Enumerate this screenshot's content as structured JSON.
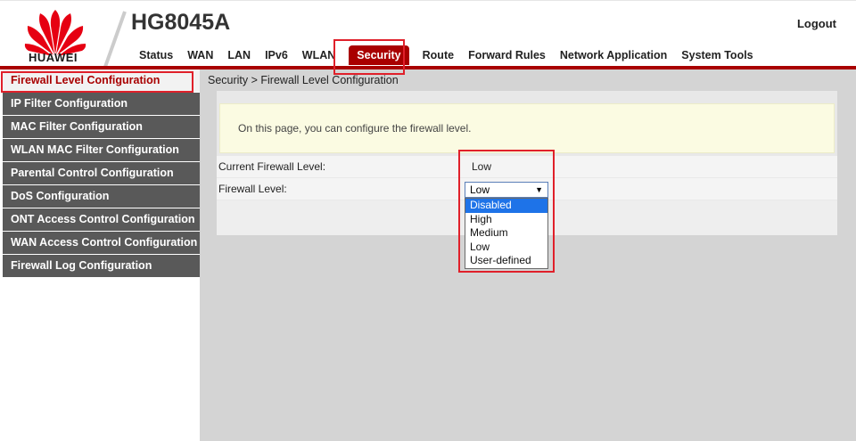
{
  "header": {
    "brand": "HUAWEI",
    "product": "HG8045A",
    "logout_label": "Logout"
  },
  "nav": {
    "items": [
      {
        "label": "Status"
      },
      {
        "label": "WAN"
      },
      {
        "label": "LAN"
      },
      {
        "label": "IPv6"
      },
      {
        "label": "WLAN"
      },
      {
        "label": "Security",
        "active": true
      },
      {
        "label": "Route"
      },
      {
        "label": "Forward Rules"
      },
      {
        "label": "Network Application"
      },
      {
        "label": "System Tools"
      }
    ]
  },
  "sidebar": {
    "items": [
      {
        "label": "Firewall Level Configuration",
        "active": true
      },
      {
        "label": "IP Filter Configuration"
      },
      {
        "label": "MAC Filter Configuration"
      },
      {
        "label": "WLAN MAC Filter Configuration"
      },
      {
        "label": "Parental Control Configuration"
      },
      {
        "label": "DoS Configuration"
      },
      {
        "label": "ONT Access Control Configuration"
      },
      {
        "label": "WAN Access Control Configuration"
      },
      {
        "label": "Firewall Log Configuration"
      }
    ]
  },
  "main": {
    "breadcrumb": "Security > Firewall Level Configuration",
    "notice": "On this page, you can configure the firewall level.",
    "current_level_label": "Current Firewall Level:",
    "current_level_value": "Low",
    "level_label": "Firewall Level:",
    "level_selected": "Low",
    "level_options": [
      "Disabled",
      "High",
      "Medium",
      "Low",
      "User-defined"
    ],
    "highlighted_option": "Disabled"
  },
  "colors": {
    "brand_red": "#a90000",
    "highlight_box": "#e0202a",
    "sidebar_bg": "#595959",
    "selection_blue": "#1e73e8"
  }
}
